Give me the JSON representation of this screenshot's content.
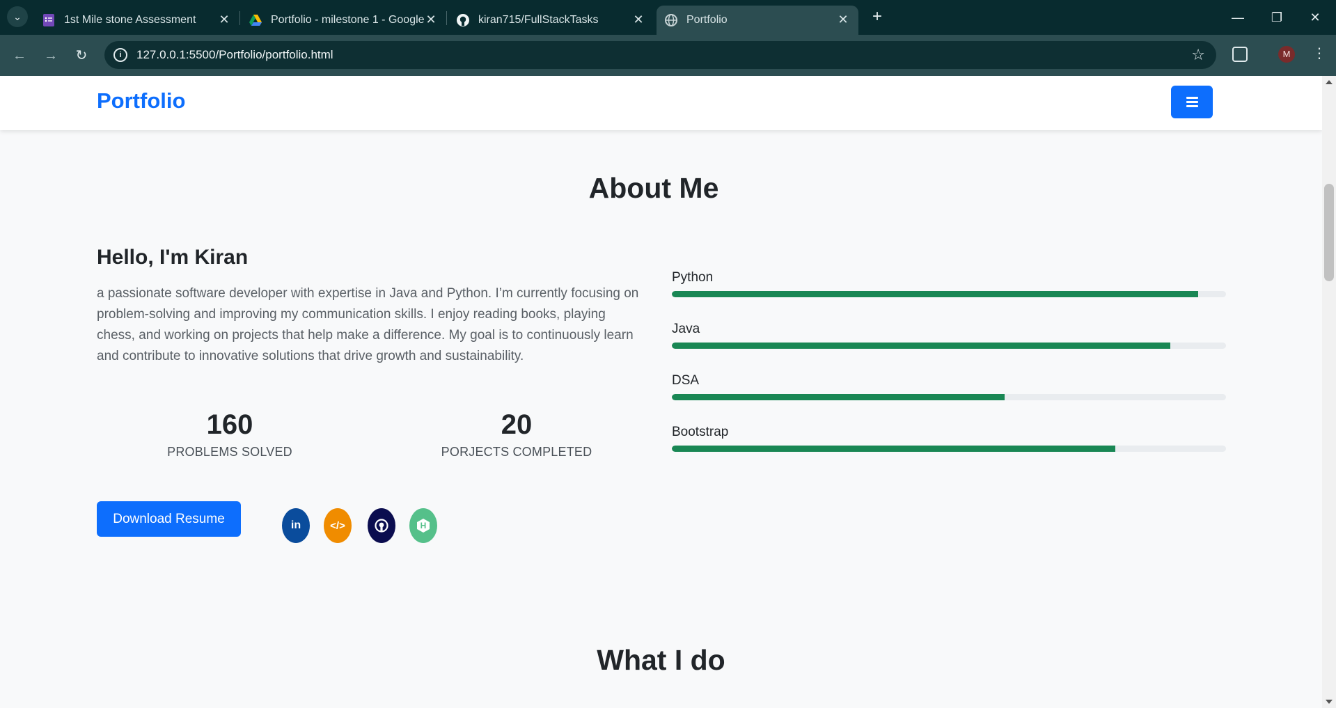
{
  "browser": {
    "tabs": [
      {
        "title": "1st Mile stone Assessment",
        "icon": "forms-icon",
        "active": false
      },
      {
        "title": "Portfolio - milestone 1 - Google",
        "icon": "google-drive-icon",
        "active": false
      },
      {
        "title": "kiran715/FullStackTasks",
        "icon": "github-icon",
        "active": false
      },
      {
        "title": "Portfolio",
        "icon": "globe-icon",
        "active": true
      }
    ],
    "url": "127.0.0.1:5500/Portfolio/portfolio.html",
    "profile_initial": "M"
  },
  "navbar": {
    "brand": "Portfolio",
    "accent_color": "#0d6efd"
  },
  "about": {
    "title": "About Me",
    "greeting": "Hello, I'm Kiran",
    "bio": "a passionate software developer with expertise in Java and Python. I’m currently focusing on problem-solving and improving my communication skills. I enjoy reading books, playing chess, and working on projects that help make a difference. My goal is to continuously learn and contribute to innovative solutions that drive growth and sustainability.",
    "stats": [
      {
        "value": "160",
        "label": "PROBLEMS SOLVED"
      },
      {
        "value": "20",
        "label": "PORJECTS COMPLETED"
      }
    ],
    "resume_button": "Download Resume",
    "social": [
      {
        "name": "linkedin-icon",
        "glyph": "in",
        "color": "#0a4c9c"
      },
      {
        "name": "code-icon",
        "glyph": "</>",
        "color": "#f08c00"
      },
      {
        "name": "github-icon",
        "glyph": "",
        "color": "#0b0d4f"
      },
      {
        "name": "hackerrank-icon",
        "glyph": "H",
        "color": "#55c08a"
      }
    ],
    "skills": [
      {
        "name": "Python",
        "level": 0.95
      },
      {
        "name": "Java",
        "level": 0.9
      },
      {
        "name": "DSA",
        "level": 0.6
      },
      {
        "name": "Bootstrap",
        "level": 0.8
      }
    ],
    "skill_color": "#198754"
  },
  "whatido": {
    "title": "What I do"
  }
}
